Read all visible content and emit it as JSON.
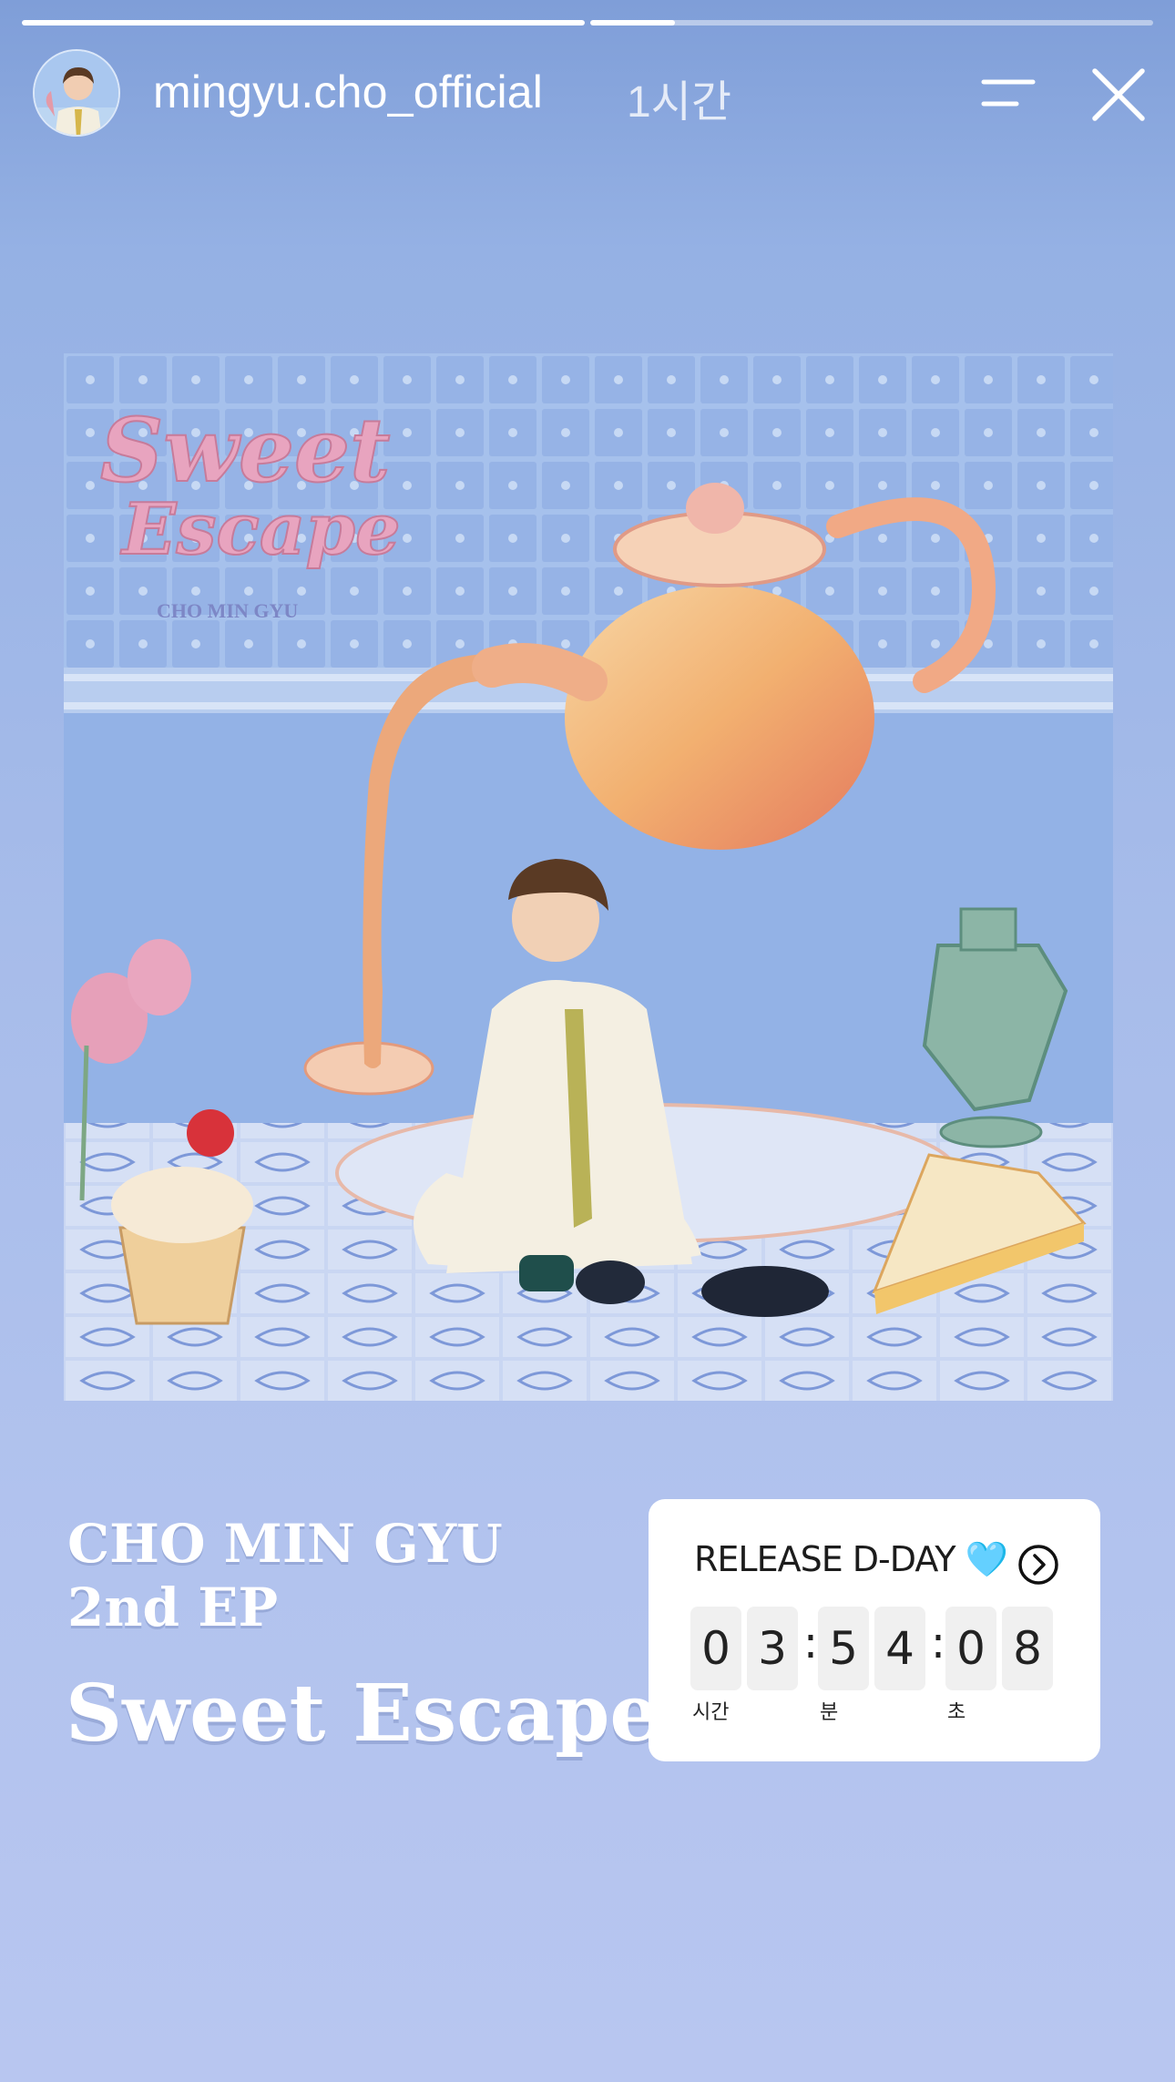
{
  "story": {
    "segments": [
      {
        "progress": 1.0
      },
      {
        "progress": 0.15
      }
    ],
    "username": "mingyu.cho_official",
    "time_ago": "1시간"
  },
  "album_art": {
    "logo_text_line1": "Sweet",
    "logo_text_line2": "Escape",
    "artist_caption": "CHO MIN GYU"
  },
  "caption": {
    "artist": "CHO MIN GYU",
    "release": "2nd EP",
    "title": "Sweet Escape"
  },
  "countdown": {
    "title": "RELEASE D-DAY 🩵",
    "digits": [
      "0",
      "3",
      "5",
      "4",
      "0",
      "8"
    ],
    "units": [
      "시간",
      "분",
      "초"
    ]
  },
  "colors": {
    "background_top": "#7f9ed8",
    "background_bottom": "#b8c6f0",
    "logo_pink": "#e8a4bf"
  },
  "icons": {
    "menu": "menu-icon",
    "close": "close-icon",
    "sticker_link": "chevron-circle-right-icon"
  }
}
